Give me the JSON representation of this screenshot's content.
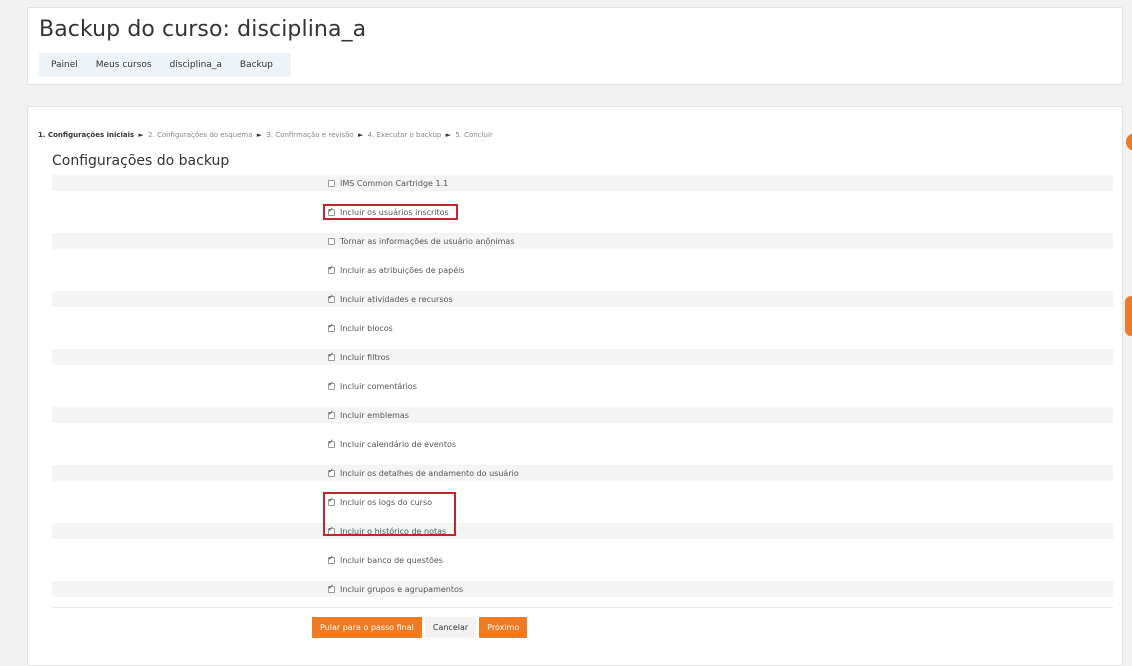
{
  "header": {
    "title": "Backup do curso: disciplina_a",
    "breadcrumb": [
      "Painel",
      "Meus cursos",
      "disciplina_a",
      "Backup"
    ]
  },
  "progress": {
    "steps": [
      "1. Configurações iniciais",
      "2. Configurações do esquema",
      "3. Confirmação e revisão",
      "4. Executar o backup",
      "5. Concluir"
    ],
    "separator": "►"
  },
  "section_title": "Configurações do backup",
  "settings": [
    {
      "label": "IMS Common Cartridge 1.1",
      "checked": false
    },
    {
      "label": "Incluir os usuários inscritos",
      "checked": true
    },
    {
      "label": "Tornar as informações de usuário anônimas",
      "checked": false
    },
    {
      "label": "Incluir as atribuições de papéis",
      "checked": true
    },
    {
      "label": "Incluir atividades e recursos",
      "checked": true
    },
    {
      "label": "Incluir blocos",
      "checked": true
    },
    {
      "label": "Incluir filtros",
      "checked": true
    },
    {
      "label": "Incluir comentários",
      "checked": true
    },
    {
      "label": "Incluir emblemas",
      "checked": true
    },
    {
      "label": "Incluir calendário de eventos",
      "checked": true
    },
    {
      "label": "Incluir os detalhes de andamento do usuário",
      "checked": true
    },
    {
      "label": "Incluir os logs do curso",
      "checked": true
    },
    {
      "label": "Incluir o histórico de notas",
      "checked": true
    },
    {
      "label": "Incluir banco de questões",
      "checked": true
    },
    {
      "label": "Incluir grupos e agrupamentos",
      "checked": true
    }
  ],
  "buttons": {
    "skip": "Pular para o passo final",
    "cancel": "Cancelar",
    "next": "Próximo"
  },
  "colors": {
    "accent": "#f07a22",
    "highlight": "#c8232c",
    "breadcrumb_bg": "#eef3f8"
  }
}
